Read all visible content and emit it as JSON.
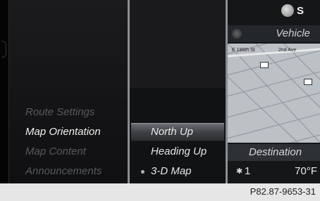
{
  "left_menu": {
    "items": [
      {
        "label": "Route Settings",
        "state": "dim"
      },
      {
        "label": "Map Orientation",
        "state": "active"
      },
      {
        "label": "Map Content",
        "state": "dim"
      },
      {
        "label": "Announcements",
        "state": "dim"
      }
    ]
  },
  "submenu": {
    "items": [
      {
        "label": "North Up",
        "selected": true
      },
      {
        "label": "Heading Up",
        "selected": false
      },
      {
        "label": "3-D Map",
        "selected": false,
        "bullet": true
      }
    ]
  },
  "right_panel": {
    "compass_label": "S",
    "vehicle_label": "Vehicle",
    "map_streets": [
      "E 186th St",
      "2nd Ave"
    ],
    "destination_label": "Destination",
    "fan_level": "1",
    "temperature": "70°F"
  },
  "footer": {
    "code": "P82.87-9653-31"
  }
}
